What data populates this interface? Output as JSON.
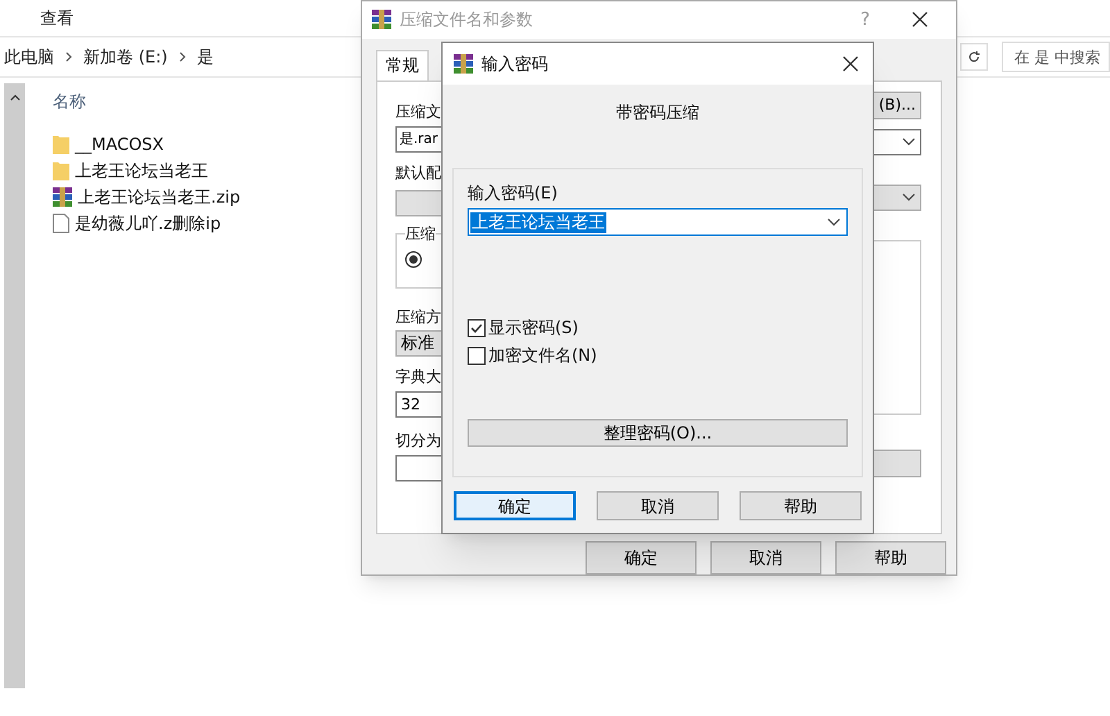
{
  "explorer": {
    "menu": [
      {
        "label": "查看"
      }
    ],
    "breadcrumb": [
      "此电脑",
      "新加卷 (E:)",
      "是"
    ],
    "search": {
      "placeholder": "在 是 中搜索"
    },
    "column": "名称",
    "files": [
      {
        "name": "__MACOSX",
        "kind": "folder"
      },
      {
        "name": "上老王论坛当老王",
        "kind": "folder"
      },
      {
        "name": "上老王论坛当老王.zip",
        "kind": "archive"
      },
      {
        "name": "是幼薇儿吖.z删除ip",
        "kind": "file"
      }
    ]
  },
  "archive_dialog": {
    "title": "压缩文件名和参数",
    "help": "?",
    "tabs": [
      {
        "label": "常规",
        "selected": true
      }
    ],
    "browse_button": "(B)...",
    "archive_name_label": "压缩文",
    "archive_name": "是.rar",
    "profile_label": "默认配",
    "format_group": "压缩",
    "format_radio": {
      "selected": true
    },
    "method_label": "压缩方",
    "method": "标准",
    "dictionary_label": "字典大",
    "dictionary": "32",
    "split_label": "切分为",
    "buttons": [
      {
        "label": "确定"
      },
      {
        "label": "取消"
      },
      {
        "label": "帮助"
      }
    ]
  },
  "password_dialog": {
    "title": "输入密码",
    "heading": "带密码压缩",
    "password_label": "输入密码(E)",
    "password": "上老王论坛当老王",
    "password_selected": true,
    "options": [
      {
        "label": "显示密码(S)",
        "checked": true
      },
      {
        "label": "加密文件名(N)",
        "checked": false
      }
    ],
    "organize_button": "整理密码(O)...",
    "buttons": [
      {
        "label": "确定",
        "default": true
      },
      {
        "label": "取消",
        "default": false
      },
      {
        "label": "帮助",
        "default": false
      }
    ]
  }
}
